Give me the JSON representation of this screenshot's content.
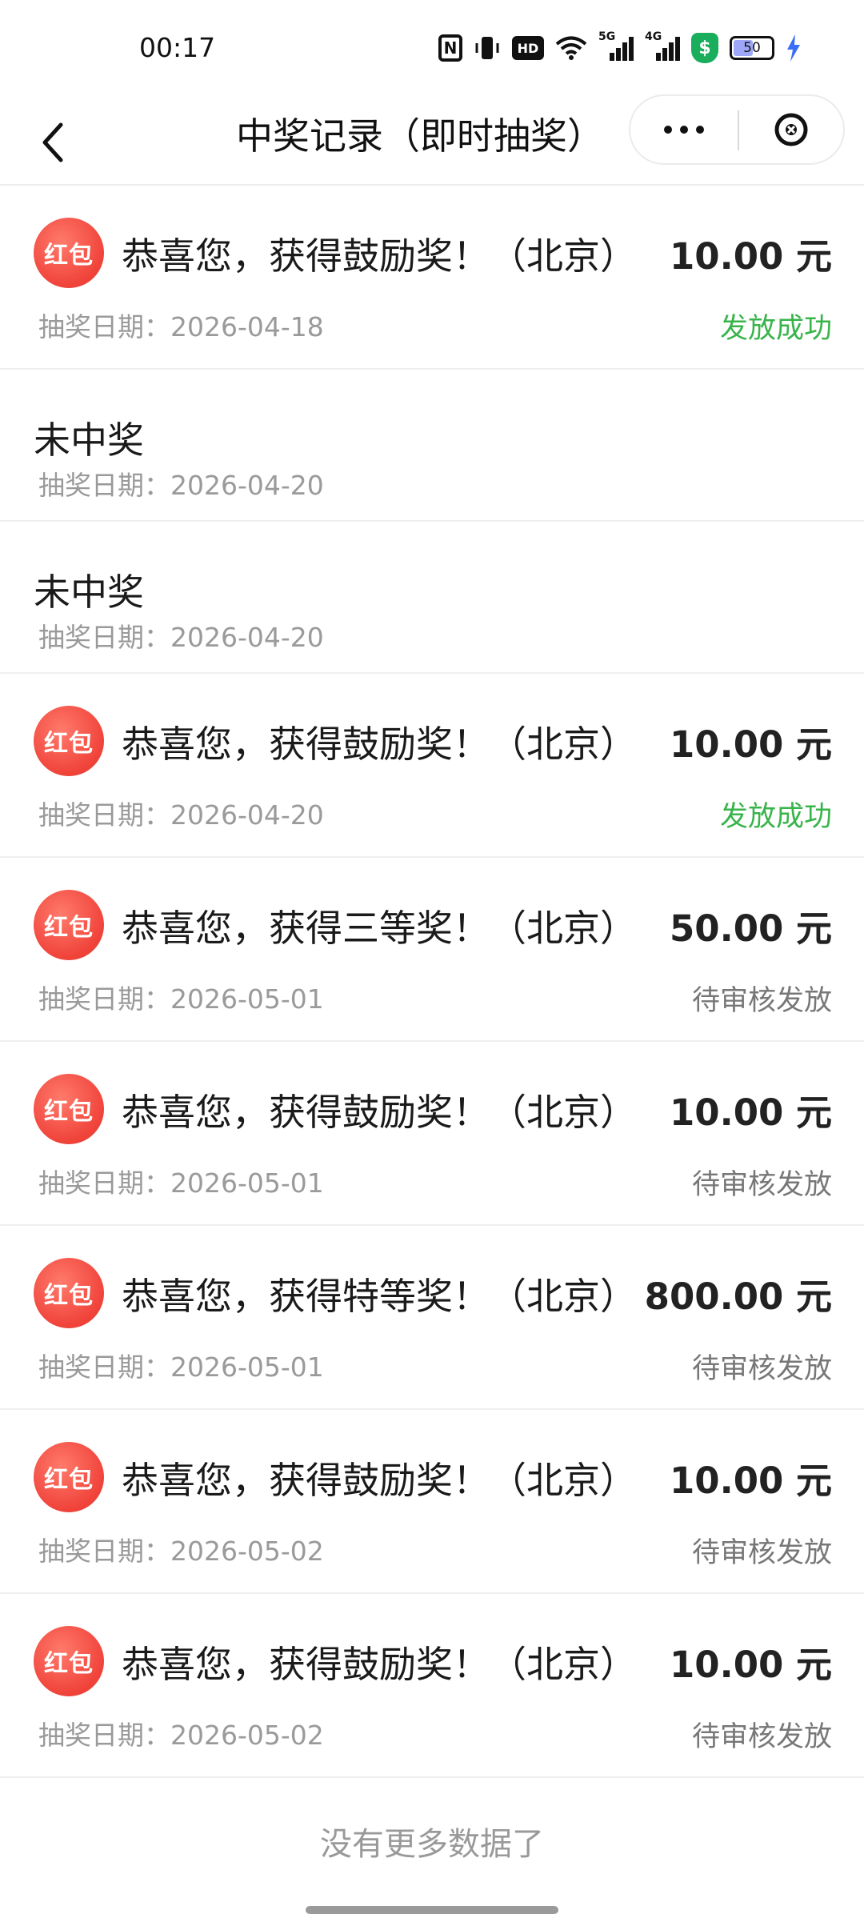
{
  "status_bar": {
    "time": "00:17",
    "hd_label": "HD",
    "sig1_tag": "5G",
    "sig2_tag": "4G",
    "battery": "50"
  },
  "nav": {
    "title": "中奖记录（即时抽奖）"
  },
  "records": [
    {
      "type": "prize",
      "badge": "红包",
      "title": "恭喜您，获得鼓励奖！（北京）",
      "amount": "10.00 元",
      "date": "抽奖日期：2026-04-18",
      "status": "发放成功",
      "status_color": "#38b44a"
    },
    {
      "type": "noprize",
      "title": "未中奖",
      "date": "抽奖日期：2026-04-20"
    },
    {
      "type": "noprize",
      "title": "未中奖",
      "date": "抽奖日期：2026-04-20"
    },
    {
      "type": "prize",
      "badge": "红包",
      "title": "恭喜您，获得鼓励奖！（北京）",
      "amount": "10.00 元",
      "date": "抽奖日期：2026-04-20",
      "status": "发放成功",
      "status_color": "#38b44a"
    },
    {
      "type": "prize",
      "badge": "红包",
      "title": "恭喜您，获得三等奖！（北京）",
      "amount": "50.00 元",
      "date": "抽奖日期：2026-05-01",
      "status": "待审核发放",
      "status_color": "#777777"
    },
    {
      "type": "prize",
      "badge": "红包",
      "title": "恭喜您，获得鼓励奖！（北京）",
      "amount": "10.00 元",
      "date": "抽奖日期：2026-05-01",
      "status": "待审核发放",
      "status_color": "#777777"
    },
    {
      "type": "prize",
      "badge": "红包",
      "title": "恭喜您，获得特等奖！（北京）",
      "amount": "800.00 元",
      "date": "抽奖日期：2026-05-01",
      "status": "待审核发放",
      "status_color": "#777777"
    },
    {
      "type": "prize",
      "badge": "红包",
      "title": "恭喜您，获得鼓励奖！（北京）",
      "amount": "10.00 元",
      "date": "抽奖日期：2026-05-02",
      "status": "待审核发放",
      "status_color": "#777777"
    },
    {
      "type": "prize",
      "badge": "红包",
      "title": "恭喜您，获得鼓励奖！（北京）",
      "amount": "10.00 元",
      "date": "抽奖日期：2026-05-02",
      "status": "待审核发放",
      "status_color": "#777777"
    }
  ],
  "footer": {
    "no_more": "没有更多数据了"
  },
  "colors": {
    "badge_red": "#f0433a",
    "success_green": "#38b44a",
    "pending_gray": "#777777"
  }
}
